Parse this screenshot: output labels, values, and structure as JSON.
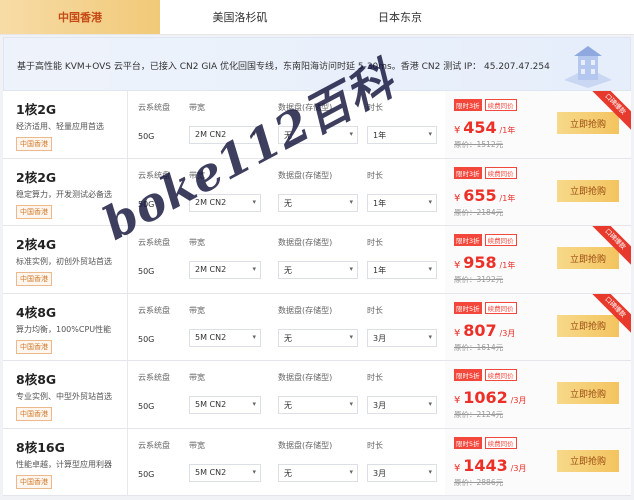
{
  "tabs": [
    {
      "label": "中国香港",
      "active": true
    },
    {
      "label": "美国洛杉矶",
      "active": false
    },
    {
      "label": "日本东京",
      "active": false
    }
  ],
  "info": {
    "text": "基于高性能 KVM+OVS 云平台，已接入 CN2 GIA 优化回国专线，东南阳海访问时延 5-30ms。香港 CN2 测试 IP： 45.207.47.254"
  },
  "column_labels": {
    "disk": "云系统盘",
    "bandwidth": "带宽",
    "datadisk": "数据盘(存储型)",
    "duration": "时长"
  },
  "plans": [
    {
      "spec": "1核2G",
      "desc": "经济适用、轻量应用首选",
      "region": "中国香港",
      "disk": "50G",
      "bandwidth": "2M CN2",
      "datadisk": "无",
      "duration": "1年",
      "badge_discount": "限时3折",
      "badge_renew": "续费同价",
      "currency": "¥",
      "price": "454",
      "per": "/1年",
      "orig": "原价：1512元",
      "buy": "立即抢购",
      "ribbon": "口碑爆款"
    },
    {
      "spec": "2核2G",
      "desc": "稳定算力，开发测试必备选",
      "region": "中国香港",
      "disk": "50G",
      "bandwidth": "2M CN2",
      "datadisk": "无",
      "duration": "1年",
      "badge_discount": "限时3折",
      "badge_renew": "续费同价",
      "currency": "¥",
      "price": "655",
      "per": "/1年",
      "orig": "原价：2184元",
      "buy": "立即抢购",
      "ribbon": ""
    },
    {
      "spec": "2核4G",
      "desc": "标准实例，初创外贸站首选",
      "region": "中国香港",
      "disk": "50G",
      "bandwidth": "2M CN2",
      "datadisk": "无",
      "duration": "1年",
      "badge_discount": "限时3折",
      "badge_renew": "续费同价",
      "currency": "¥",
      "price": "958",
      "per": "/1年",
      "orig": "原价：3192元",
      "buy": "立即抢购",
      "ribbon": "口碑爆款"
    },
    {
      "spec": "4核8G",
      "desc": "算力均衡，100%CPU性能",
      "region": "中国香港",
      "disk": "50G",
      "bandwidth": "5M CN2",
      "datadisk": "无",
      "duration": "3月",
      "badge_discount": "限时5折",
      "badge_renew": "续费同价",
      "currency": "¥",
      "price": "807",
      "per": "/3月",
      "orig": "原价：1614元",
      "buy": "立即抢购",
      "ribbon": "口碑爆款"
    },
    {
      "spec": "8核8G",
      "desc": "专业实例、中型外贸站首选",
      "region": "中国香港",
      "disk": "50G",
      "bandwidth": "5M CN2",
      "datadisk": "无",
      "duration": "3月",
      "badge_discount": "限时5折",
      "badge_renew": "续费同价",
      "currency": "¥",
      "price": "1062",
      "per": "/3月",
      "orig": "原价：2124元",
      "buy": "立即抢购",
      "ribbon": ""
    },
    {
      "spec": "8核16G",
      "desc": "性能卓越，计算型应用利器",
      "region": "中国香港",
      "disk": "50G",
      "bandwidth": "5M CN2",
      "datadisk": "无",
      "duration": "3月",
      "badge_discount": "限时5折",
      "badge_renew": "续费同价",
      "currency": "¥",
      "price": "1443",
      "per": "/3月",
      "orig": "原价：2886元",
      "buy": "立即抢购",
      "ribbon": ""
    }
  ],
  "watermark": "boke112百科",
  "colors": {
    "accent": "#ec2f27",
    "tab_active": "#f1c978",
    "button": "#f3c45f"
  }
}
